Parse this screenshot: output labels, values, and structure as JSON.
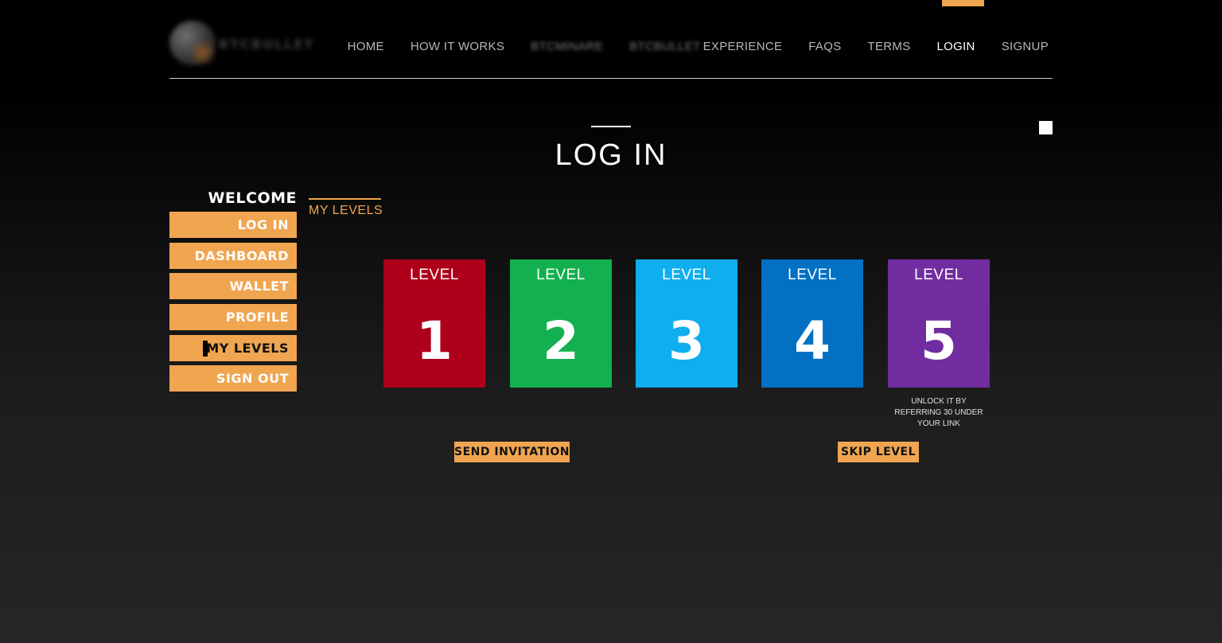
{
  "header": {
    "logo_text": "BTCBULLET",
    "nav": [
      {
        "label": "HOME"
      },
      {
        "label": "HOW IT WORKS"
      },
      {
        "label": "BTCMINARE"
      },
      {
        "label": "BTCBULLET"
      },
      {
        "label": "EXPERIENCE"
      },
      {
        "label": "FAQS"
      },
      {
        "label": "TERMS"
      },
      {
        "label": "LOGIN"
      },
      {
        "label": "SIGNUP"
      }
    ]
  },
  "page_title": "LOG IN",
  "sidebar": {
    "welcome": "WELCOME",
    "items": [
      {
        "label": "LOG IN"
      },
      {
        "label": "DASHBOARD"
      },
      {
        "label": "WALLET"
      },
      {
        "label": "PROFILE"
      },
      {
        "label": "MY LEVELS"
      },
      {
        "label": "SIGN OUT"
      }
    ]
  },
  "section_tab": "MY LEVELS",
  "levels": [
    {
      "label": "LEVEL",
      "number": "1",
      "color": "#ae001b"
    },
    {
      "label": "LEVEL",
      "number": "2",
      "color": "#13b04f"
    },
    {
      "label": "LEVEL",
      "number": "3",
      "color": "#0faeee"
    },
    {
      "label": "LEVEL",
      "number": "4",
      "color": "#0270c3"
    },
    {
      "label": "LEVEL",
      "number": "5",
      "color": "#712da0"
    }
  ],
  "unlock_note": "UNLOCK IT BY REFERRING 30 UNDER YOUR LINK",
  "actions": {
    "send_invitation": "SEND INVITATION",
    "skip_level": "SKIP LEVEL"
  },
  "colors": {
    "accent": "#f0a550"
  }
}
